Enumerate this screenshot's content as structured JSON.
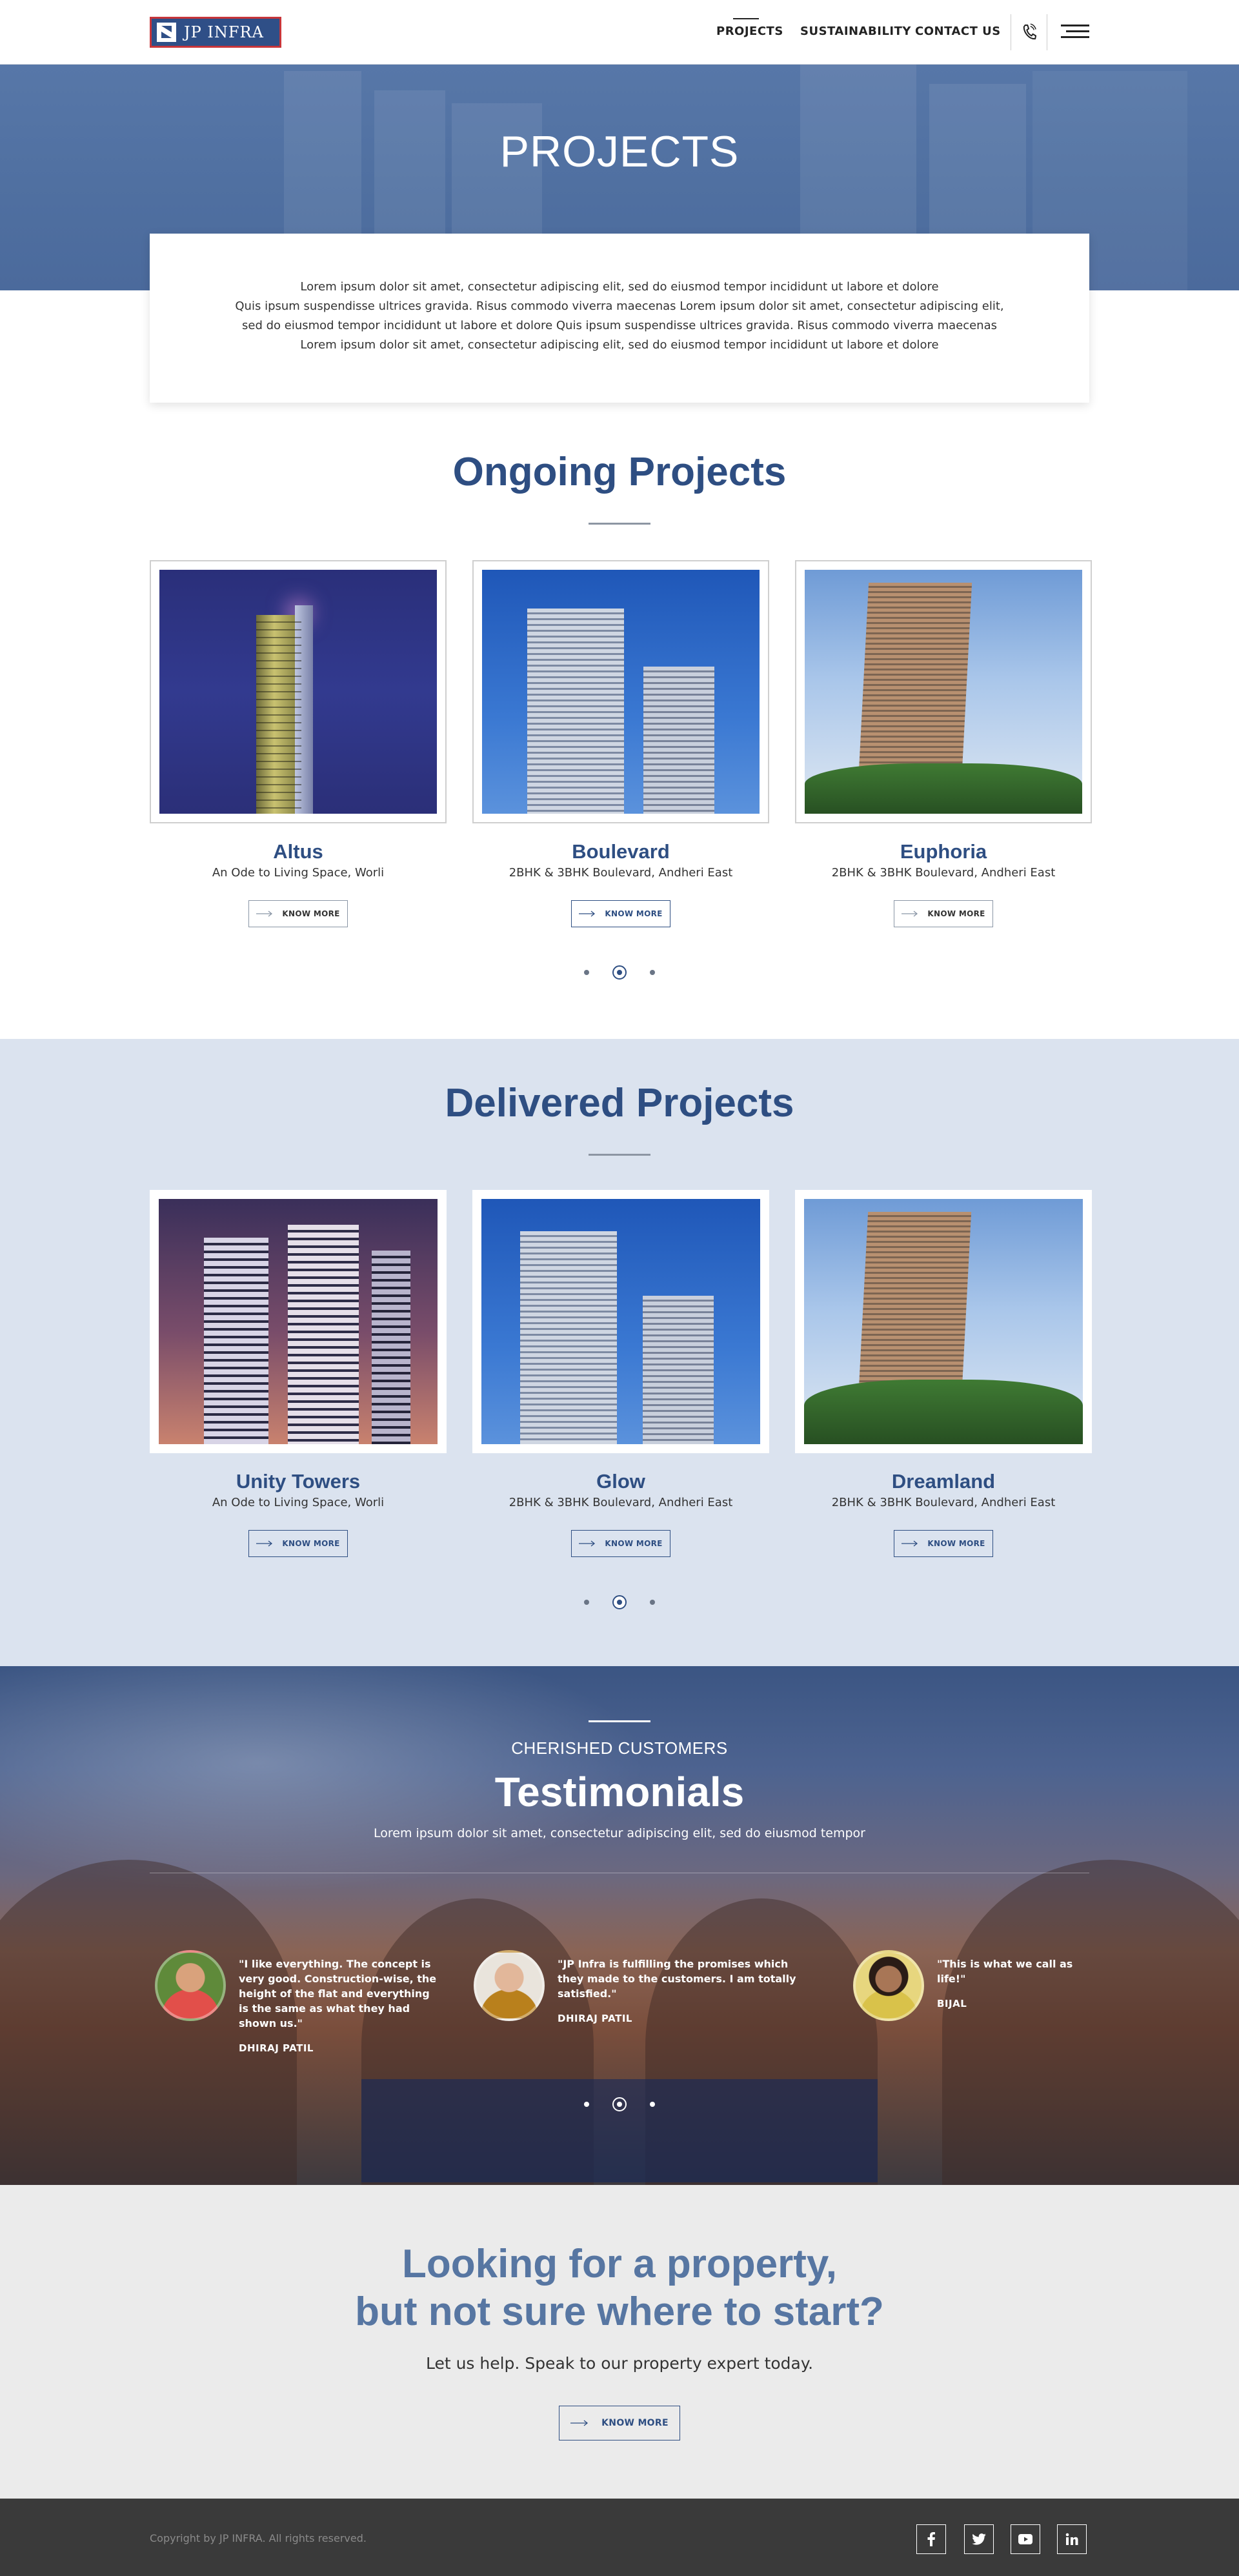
{
  "brand": {
    "name": "JP INFRA"
  },
  "nav": {
    "items": [
      "PROJECTS",
      "SUSTAINABILITY",
      "CONTACT US"
    ],
    "phone_icon": "phone-icon",
    "menu_icon": "hamburger-menu-icon"
  },
  "hero": {
    "title": "PROJECTS"
  },
  "intro": {
    "lines": [
      "Lorem ipsum dolor sit amet, consectetur adipiscing elit, sed do eiusmod tempor incididunt ut labore et dolore",
      "Quis ipsum suspendisse ultrices gravida. Risus commodo viverra maecenas Lorem ipsum dolor sit amet, consectetur adipiscing elit,",
      "sed do eiusmod tempor incididunt ut labore et dolore Quis ipsum suspendisse ultrices gravida. Risus commodo viverra maecenas",
      "Lorem ipsum dolor sit amet, consectetur adipiscing elit, sed do eiusmod tempor incididunt ut labore et dolore"
    ]
  },
  "ongoing": {
    "title": "Ongoing Projects",
    "cards": [
      {
        "name": "Altus",
        "subtitle": "An Ode to Living Space, Worli",
        "button": "KNOW MORE"
      },
      {
        "name": "Boulevard",
        "subtitle": "2BHK & 3BHK Boulevard, Andheri East",
        "button": "KNOW MORE"
      },
      {
        "name": "Euphoria",
        "subtitle": "2BHK & 3BHK Boulevard, Andheri East",
        "button": "KNOW MORE"
      }
    ],
    "active_dot": 2
  },
  "delivered": {
    "title": "Delivered Projects",
    "cards": [
      {
        "name": "Unity Towers",
        "subtitle": "An Ode to Living Space, Worli",
        "button": "KNOW MORE"
      },
      {
        "name": "Glow",
        "subtitle": "2BHK & 3BHK Boulevard, Andheri East",
        "button": "KNOW MORE"
      },
      {
        "name": "Dreamland",
        "subtitle": "2BHK & 3BHK Boulevard, Andheri East",
        "button": "KNOW MORE"
      }
    ],
    "active_dot": 2
  },
  "testimonials": {
    "kicker": "CHERISHED CUSTOMERS",
    "title": "Testimonials",
    "subtitle": "Lorem ipsum dolor sit amet, consectetur adipiscing elit, sed do eiusmod tempor",
    "reviews": [
      {
        "quote": "\"I like everything. The concept is very good. Construction-wise, the height of the flat and everything is the same as what they had shown us.\"",
        "name": "DHIRAJ PATIL"
      },
      {
        "quote": "\"JP Infra is fulfilling the promises which they made to the customers. I am totally satisfied.\"",
        "name": "DHIRAJ PATIL"
      },
      {
        "quote": "\"This is what we call as life!\"",
        "name": "BIJAL"
      }
    ],
    "active_dot": 2
  },
  "cta": {
    "title_line1": "Looking for a property,",
    "title_line2": "but not sure where to start?",
    "subtitle": "Let us help. Speak to our property expert today.",
    "button": "KNOW MORE"
  },
  "footer": {
    "copyright": "Copyright by JP INFRA. All rights reserved.",
    "social": [
      "f",
      "t",
      "yt",
      "in"
    ]
  },
  "colors": {
    "brand_blue": "#2e4e82",
    "brand_red": "#c7353a",
    "delivered_bg": "#dbe3ef",
    "footer_bg": "#3a3a3a"
  }
}
